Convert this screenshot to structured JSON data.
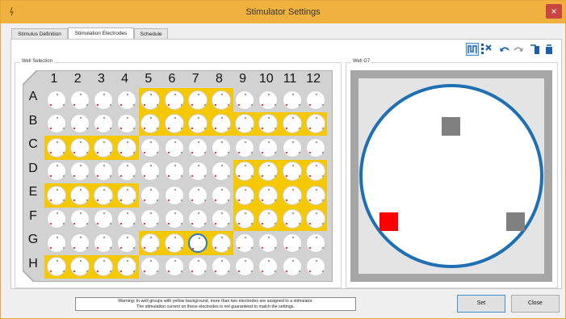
{
  "window": {
    "title": "Stimulator Settings",
    "close_label": "×"
  },
  "tabs": [
    {
      "label": "Stimulus Definition",
      "active": false
    },
    {
      "label": "Stimulation Electrodes",
      "active": true
    },
    {
      "label": "Schedule",
      "active": false
    }
  ],
  "toolbar": {
    "icons": [
      "electrode-view-icon",
      "grid-clear-icon",
      "undo-icon",
      "redo-icon",
      "import-icon",
      "export-icon"
    ]
  },
  "well_selection": {
    "label": "Well Selection",
    "columns": [
      "1",
      "2",
      "3",
      "4",
      "5",
      "6",
      "7",
      "8",
      "9",
      "10",
      "11",
      "12"
    ],
    "rows": [
      "A",
      "B",
      "C",
      "D",
      "E",
      "F",
      "G",
      "H"
    ],
    "highlighted": {
      "A": [
        5,
        6,
        7,
        8
      ],
      "B": [
        5,
        6,
        7,
        8,
        9,
        10,
        11,
        12
      ],
      "C": [
        1,
        2,
        3,
        4
      ],
      "D": [
        9,
        10,
        11,
        12
      ],
      "E": [
        1,
        2,
        3,
        4,
        9,
        10,
        11,
        12
      ],
      "F": [
        9,
        10,
        11,
        12
      ],
      "G": [
        5,
        6,
        7,
        8
      ],
      "H": [
        1,
        2,
        3,
        4
      ]
    },
    "selected_well": "G7",
    "colors": {
      "highlight": "#f5c800",
      "selected_ring": "#2f79b9"
    }
  },
  "well_detail": {
    "label": "Well G7",
    "electrodes": [
      {
        "id": "top",
        "state": "inactive",
        "color": "#808080"
      },
      {
        "id": "bottom-left",
        "state": "active",
        "color": "#ff0000"
      },
      {
        "id": "bottom-right",
        "state": "inactive",
        "color": "#808080"
      }
    ],
    "ring_color": "#1f6fb5"
  },
  "warning": {
    "line1": "Warning: In well groups with yellow background, more than two electrodes are assigned to a stimulator.",
    "line2": "The stimulation current on these electrodes is not guaranteed to match the settings."
  },
  "buttons": {
    "set_label": "Set",
    "close_label": "Close"
  }
}
